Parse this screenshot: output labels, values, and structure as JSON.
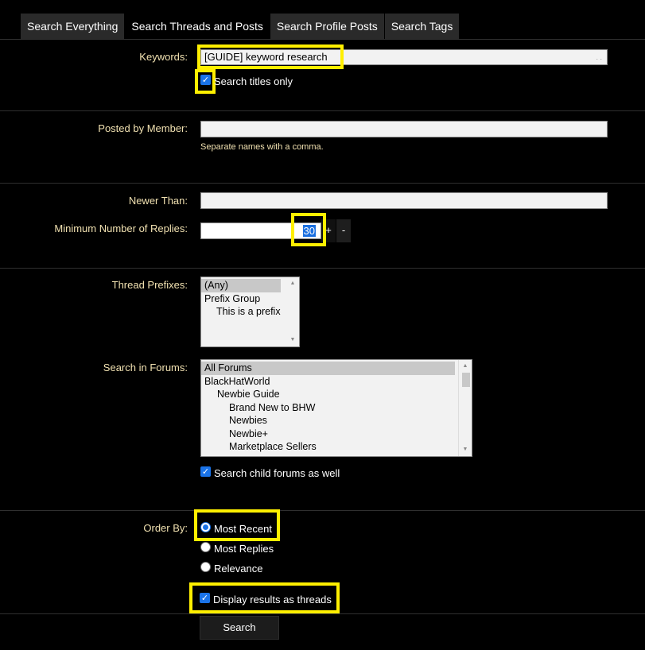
{
  "tabs": [
    {
      "label": "Search Everything"
    },
    {
      "label": "Search Threads and Posts"
    },
    {
      "label": "Search Profile Posts"
    },
    {
      "label": "Search Tags"
    }
  ],
  "keywords": {
    "label": "Keywords:",
    "value": "[GUIDE] keyword research",
    "titles_only_label": "Search titles only"
  },
  "posted_by": {
    "label": "Posted by Member:",
    "value": "",
    "hint": "Separate names with a comma."
  },
  "newer_than": {
    "label": "Newer Than:",
    "value": ""
  },
  "min_replies": {
    "label": "Minimum Number of Replies:",
    "value": "30",
    "plus": "+",
    "minus": "-"
  },
  "prefixes": {
    "label": "Thread Prefixes:",
    "items": [
      "(Any)",
      "Prefix Group",
      "This is a prefix"
    ]
  },
  "forums": {
    "label": "Search in Forums:",
    "items": [
      "All Forums",
      "BlackHatWorld",
      "Newbie Guide",
      "Brand New to BHW",
      "Newbies",
      "Newbie+",
      "Marketplace Sellers"
    ],
    "child_label": "Search child forums as well"
  },
  "order_by": {
    "label": "Order By:",
    "options": [
      "Most Recent",
      "Most Replies",
      "Relevance"
    ],
    "display_threads_label": "Display results as threads"
  },
  "search_button": "Search",
  "colors": {
    "highlight": "#ffef00",
    "label": "#f0e0b0",
    "accent": "#1a73e8"
  }
}
